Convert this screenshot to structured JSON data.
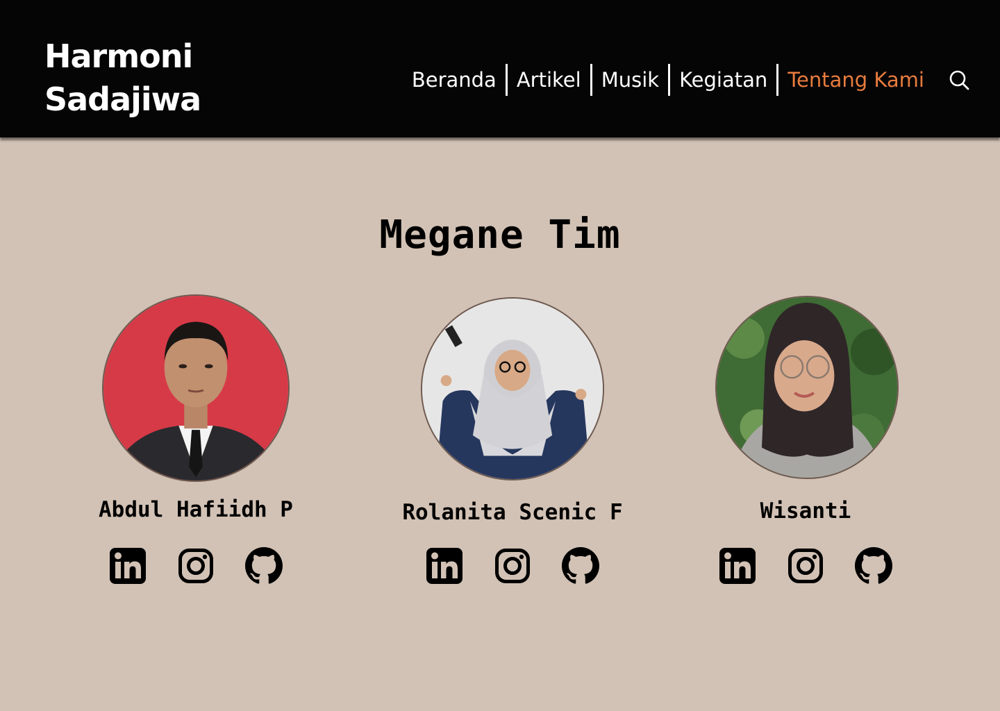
{
  "brand": {
    "line1": "Harmoni",
    "line2": "Sadajiwa"
  },
  "nav": {
    "items": [
      {
        "label": "Beranda",
        "active": false
      },
      {
        "label": "Artikel",
        "active": false
      },
      {
        "label": "Musik",
        "active": false
      },
      {
        "label": "Kegiatan",
        "active": false
      },
      {
        "label": "Tentang Kami",
        "active": true
      }
    ],
    "search_icon": "search-icon"
  },
  "team": {
    "title": "Megane Tim",
    "members": [
      {
        "name": "Abdul Hafiidh P",
        "photo_bg": "#d63a47",
        "socials": [
          "linkedin-icon",
          "instagram-icon",
          "github-icon"
        ]
      },
      {
        "name": "Rolanita Scenic F",
        "photo_bg": "#e6e6e6",
        "socials": [
          "linkedin-icon",
          "instagram-icon",
          "github-icon"
        ]
      },
      {
        "name": "Wisanti",
        "photo_bg": "#3f6b34",
        "socials": [
          "linkedin-icon",
          "instagram-icon",
          "github-icon"
        ]
      }
    ]
  },
  "colors": {
    "header_bg": "#050505",
    "page_bg": "#d2c2b5",
    "active_nav": "#e87c3e"
  }
}
